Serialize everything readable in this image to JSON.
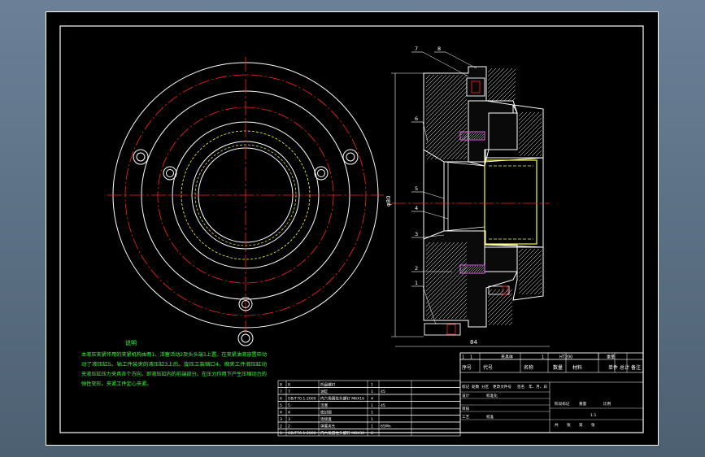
{
  "colors": {
    "background": "#000000",
    "frame": "#ffffff",
    "centerline": "#ff2020",
    "highlight": "#ffff30",
    "notes": "#30ff30",
    "hatch": "#ffffff"
  },
  "notes": {
    "heading": "说明",
    "lines": [
      "本液压夹紧作用的夹紧机构由两1、活塞活动2及头头端1上置。在夹紧油液容置中动",
      "动了液压缸5。轴工件装夹的液压缸3上后。旋压工装缩口4。缩夹工件液压缸动",
      "夹液压缸压力夹具各个方向。即液压缸内的前端部分。在压力作用下产生压缩动力的",
      "弹性变形。夹紧工件定心夹紧。"
    ]
  },
  "part_balloons": [
    "7",
    "8",
    "6",
    "5",
    "4",
    "3",
    "2",
    "1"
  ],
  "dimension_labels": {
    "diameter": "φ80",
    "length": "84"
  },
  "bom_rows": [
    {
      "no": "8",
      "code": "8",
      "name": "托盘螺钉",
      "qty": "1",
      "mat": "",
      "note": ""
    },
    {
      "no": "7",
      "code": "7",
      "name": "油缸",
      "qty": "1",
      "mat": "45",
      "note": ""
    },
    {
      "no": "6",
      "code": "GB/T70.1-2000",
      "name": "内六角圆柱头螺钉 M6X16",
      "qty": "4",
      "mat": "",
      "note": ""
    },
    {
      "no": "5",
      "code": "5",
      "name": "活塞",
      "qty": "1",
      "mat": "45",
      "note": ""
    },
    {
      "no": "4",
      "code": "4",
      "name": "密封圈",
      "qty": "1",
      "mat": "",
      "note": ""
    },
    {
      "no": "3",
      "code": "3",
      "name": "连接盘",
      "qty": "1",
      "mat": "",
      "note": ""
    },
    {
      "no": "2",
      "code": "2",
      "name": "弹簧夹头",
      "qty": "1",
      "mat": "65Mn",
      "note": ""
    },
    {
      "no": "1",
      "code": "GB/T70.1-2000",
      "name": "内六角圆柱头螺钉 M8X30",
      "qty": "6",
      "mat": "",
      "note": ""
    }
  ],
  "title_block": {
    "top_row": [
      "1",
      "1",
      "夹具体",
      "1",
      "HT200"
    ],
    "headers": [
      "序号",
      "代号",
      "名称",
      "数量",
      "材料",
      "单件",
      "总计",
      "备注"
    ],
    "weight_header": "重量",
    "revision_cells": [
      "标记",
      "处数",
      "分区",
      "更改文件号",
      "签名",
      "年、月、日"
    ],
    "design_cells": [
      "设计",
      "标准化"
    ],
    "review_cells": [
      "审核"
    ],
    "process_cells": [
      "工艺",
      "批准"
    ],
    "stage_labels": [
      "阶段标记",
      "重量",
      "比例"
    ],
    "ratio": "1:1",
    "sheet_labels": [
      "共",
      "张",
      "第",
      "张"
    ]
  }
}
